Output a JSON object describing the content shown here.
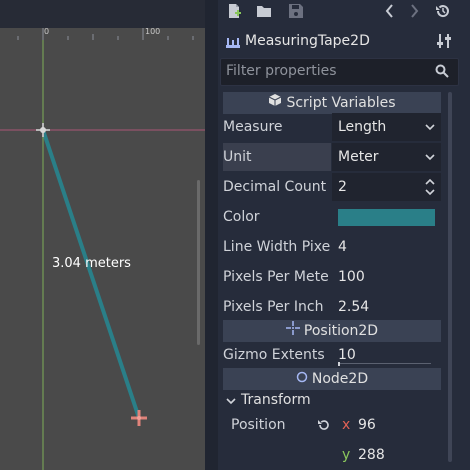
{
  "viewport": {
    "ruler_marks": [
      "0",
      "100"
    ],
    "measure_label": "3.04 meters",
    "line_color": "#2a7f88",
    "axis_colors": {
      "vertical": "#8ac75c",
      "horizontal": "#c25b82"
    }
  },
  "toolbar": {
    "icons": [
      "new-script-icon",
      "open-folder-icon",
      "save-icon",
      "history-back-icon",
      "history-forward-icon",
      "history-icon"
    ]
  },
  "inspector": {
    "node_name": "MeasuringTape2D",
    "filter_placeholder": "Filter properties",
    "sections": {
      "script_variables": "Script Variables",
      "position2d": "Position2D",
      "node2d": "Node2D",
      "transform": "Transform"
    },
    "properties": {
      "measure": {
        "label": "Measure",
        "value": "Length"
      },
      "unit": {
        "label": "Unit",
        "value": "Meter"
      },
      "decimal_count": {
        "label": "Decimal Count",
        "value": "2"
      },
      "color": {
        "label": "Color",
        "value": "#2a7f88"
      },
      "line_width": {
        "label": "Line Width Pixe",
        "value": "4"
      },
      "pixels_per_meter": {
        "label": "Pixels Per Mete",
        "value": "100"
      },
      "pixels_per_inch": {
        "label": "Pixels Per Inch",
        "value": "2.54"
      },
      "gizmo_extents": {
        "label": "Gizmo Extents",
        "value": "10"
      },
      "position": {
        "label": "Position",
        "x_label": "x",
        "x": "96",
        "y_label": "y",
        "y": "288"
      }
    }
  }
}
